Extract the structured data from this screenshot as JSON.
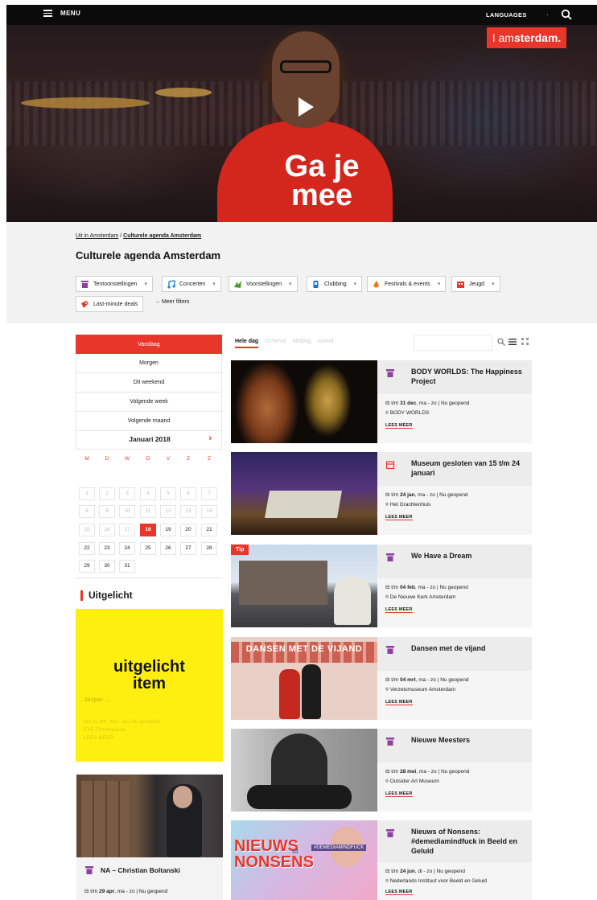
{
  "topbar": {
    "menu_label": "MENU",
    "languages_label": "LANGUAGES",
    "separator": "·"
  },
  "hero": {
    "slogan_line1": "Ga je",
    "slogan_line2": "mee",
    "brand_prefix": "I am",
    "brand_suffix": "sterdam."
  },
  "breadcrumb": {
    "home": "Uit in Amsterdam",
    "separator": "/",
    "current": "Culturele agenda Amsterdam"
  },
  "page_title": "Culturele agenda Amsterdam",
  "filters": {
    "chips": [
      "Tentoonstellingen",
      "Concerten",
      "Voorstellingen",
      "Clubbing",
      "Festivals & events",
      "Jeugd"
    ],
    "last_minute": "Last-minute deals",
    "more_filters": "→ Meer filters"
  },
  "date_filter": {
    "items": [
      "Vandaag",
      "Morgen",
      "Dit weekend",
      "Volgende week",
      "Volgende maand"
    ],
    "month": "Januari 2018",
    "next": "›",
    "weekdays": [
      "M",
      "D",
      "W",
      "D",
      "V",
      "Z",
      "Z"
    ],
    "days": [
      "1",
      "2",
      "3",
      "4",
      "5",
      "6",
      "7",
      "8",
      "9",
      "10",
      "11",
      "12",
      "13",
      "14",
      "15",
      "16",
      "17",
      "18",
      "19",
      "20",
      "21",
      "22",
      "23",
      "24",
      "25",
      "26",
      "27",
      "28",
      "29",
      "30",
      "31"
    ],
    "today": "18"
  },
  "featured": {
    "heading": "Uitgelicht",
    "placeholder_line1": "uitgelicht",
    "placeholder_line2": "item",
    "ghost_title": "Jasper ...",
    "ghost_date": "t/m 11 mrt, ma - zo | Nu geopend",
    "ghost_loc": "EYE Filmmuseum",
    "ghost_more": "LEES MEER"
  },
  "featured_event": {
    "title": "NA – Christian Boltanski",
    "date_bold": "29 apr",
    "date_prefix": "t/m ",
    "date_suffix": ", ma - zo | Nu geopend"
  },
  "list_tabs": [
    "Hele dag",
    "Ochtend",
    "Middag",
    "Avond"
  ],
  "search": {
    "placeholder": ""
  },
  "events": [
    {
      "title": "BODY WORLDS: The Happiness Project",
      "date_prefix": "t/m ",
      "date_bold": "31 dec",
      "date_suffix": ", ma - zo | Nu geopend",
      "location": "BODY WORLDS",
      "more": "LEES MEER"
    },
    {
      "title": "Museum gesloten van 15 t/m 24 januari",
      "date_prefix": "t/m ",
      "date_bold": "24 jan",
      "date_suffix": ", ma - zo | Nu geopend",
      "location": "Het Grachtenhuis",
      "more": "LEES MEER"
    },
    {
      "title": "We Have a Dream",
      "tip": "Tip",
      "date_prefix": "t/m ",
      "date_bold": "04 feb",
      "date_suffix": ", ma - zo | Nu geopend",
      "location": "De Nieuwe Kerk Amsterdam",
      "more": "LEES MEER"
    },
    {
      "title": "Dansen met de vijand",
      "image_text": "DANSEN MET DE VIJAND",
      "date_prefix": "t/m ",
      "date_bold": "04 mrt",
      "date_suffix": ", ma - zo | Nu geopend",
      "location": "Verzetsmuseum Amsterdam",
      "more": "LEES MEER"
    },
    {
      "title": "Nieuwe Meesters",
      "date_prefix": "t/m ",
      "date_bold": "28 mei",
      "date_suffix": ", ma - zo | Nu geopend",
      "location": "Outsider Art Museum",
      "more": "LEES MEER"
    },
    {
      "title": "Nieuws of Nonsens: #demediamindfuck in Beeld en Geluid",
      "image_text_1": "NIEUWS",
      "image_text_2": "of",
      "image_text_3": "NONSENS",
      "image_tag": "#DEMEDIAMINDFUCK",
      "date_prefix": "t/m ",
      "date_bold": "24 jun",
      "date_suffix": ", di - zo | Nu geopend",
      "location": "Nederlands Instituut voor Beeld en Geluid",
      "more": "LEES MEER"
    }
  ],
  "colors": {
    "accent": "#e8362b",
    "topbar": "#0b0b0b",
    "panel": "#f2f2f2",
    "featured": "#ffef10"
  }
}
